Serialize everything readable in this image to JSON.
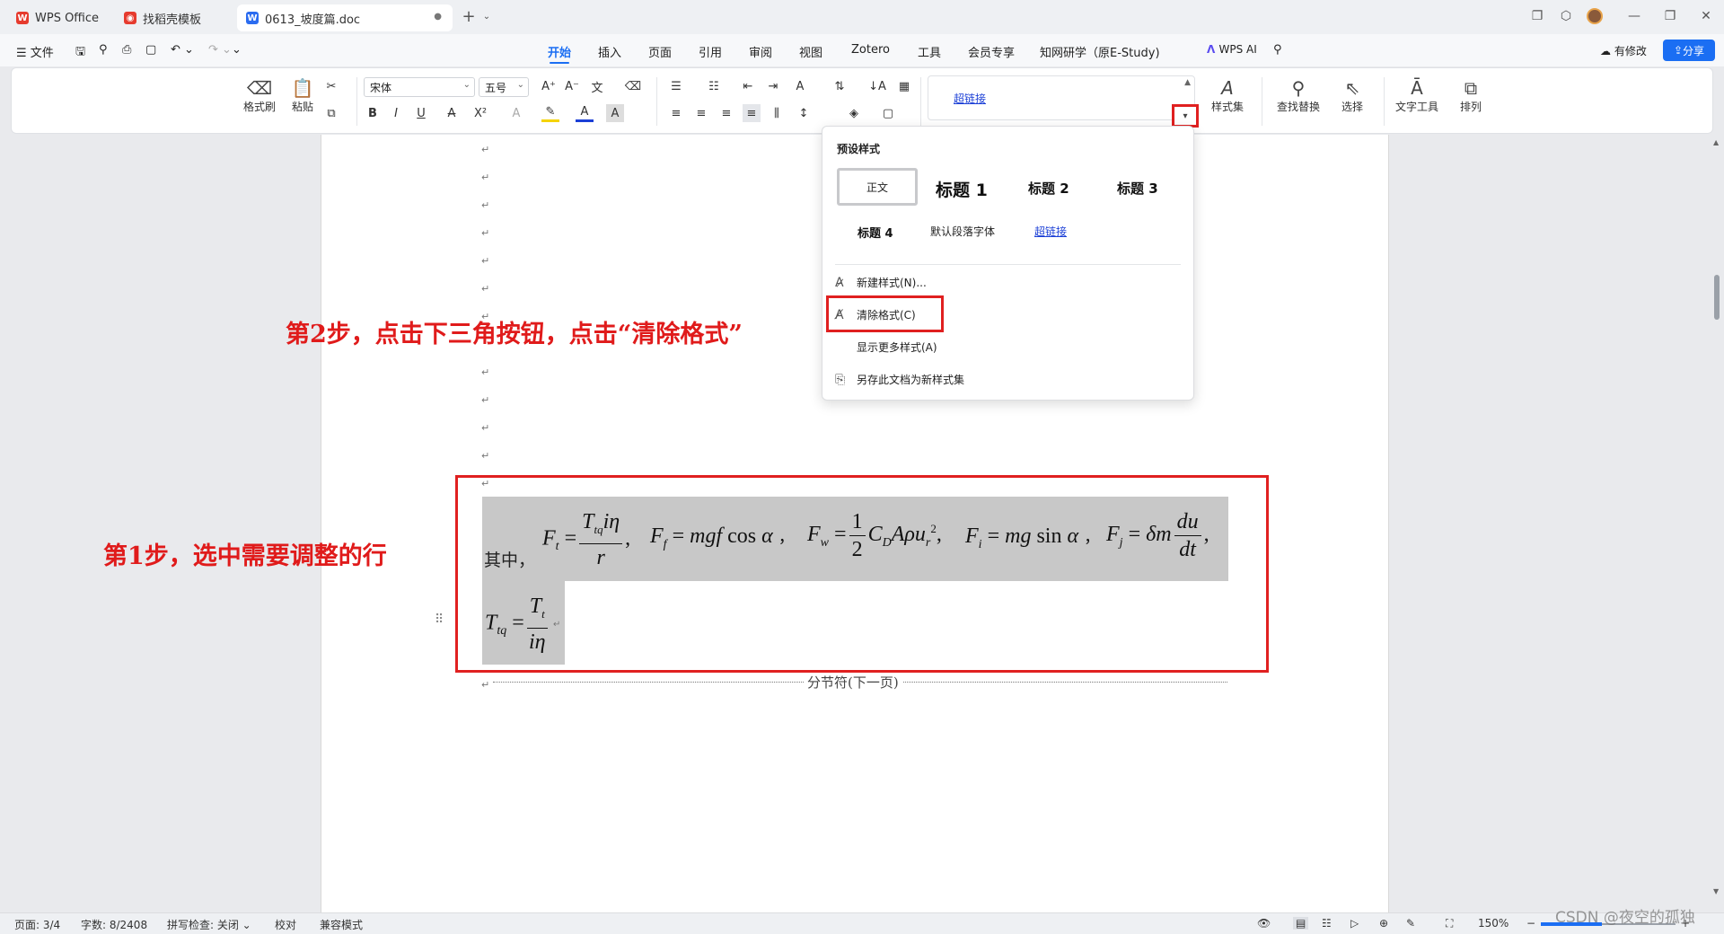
{
  "tabs": [
    {
      "label": "WPS Office",
      "icon": "wps-logo-icon",
      "color": "#e63b2e"
    },
    {
      "label": "找稻壳模板",
      "icon": "docer-icon",
      "color": "#e63b2e"
    },
    {
      "label": "0613_坡度篇.doc",
      "icon": "word-doc-icon",
      "color": "#2b6cf0"
    }
  ],
  "menubar": {
    "file": "文件",
    "items": [
      "开始",
      "插入",
      "页面",
      "引用",
      "审阅",
      "视图",
      "Zotero",
      "工具",
      "会员专享",
      "知网研学（原E-Study)"
    ],
    "wps_ai": "WPS AI",
    "modified": "有修改",
    "share": "分享",
    "accent": "#1b6ef3"
  },
  "ribbon": {
    "format_painter": "格式刷",
    "paste": "粘贴",
    "font_name": "宋体",
    "font_size": "五号",
    "style_preview": "超链接",
    "style_set": "样式集",
    "find_replace": "查找替换",
    "select": "选择",
    "text_tools": "文字工具",
    "arrange": "排列"
  },
  "document": {
    "annotation_step1": "第1步，选中需要调整的行",
    "annotation_step2": "第2步，点击下三角按钮，点击“清除格式”",
    "prefix_text": "其中，",
    "section_break": "分节符(下一页)",
    "annotation_color": "#e01b1b"
  },
  "popup": {
    "title": "预设样式",
    "styles": [
      "正文",
      "标题 1",
      "标题 2",
      "标题 3",
      "标题 4",
      "默认段落字体",
      "超链接"
    ],
    "items": [
      "新建样式(N)...",
      "清除格式(C)",
      "显示更多样式(A)",
      "另存此文档为新样式集"
    ]
  },
  "statusbar": {
    "page": "页面: 3/4",
    "words": "字数: 8/2408",
    "spellcheck": "拼写检查: 关闭",
    "proofread": "校对",
    "compat": "兼容模式",
    "zoom": "150%",
    "watermark": "CSDN @夜空的孤独"
  }
}
